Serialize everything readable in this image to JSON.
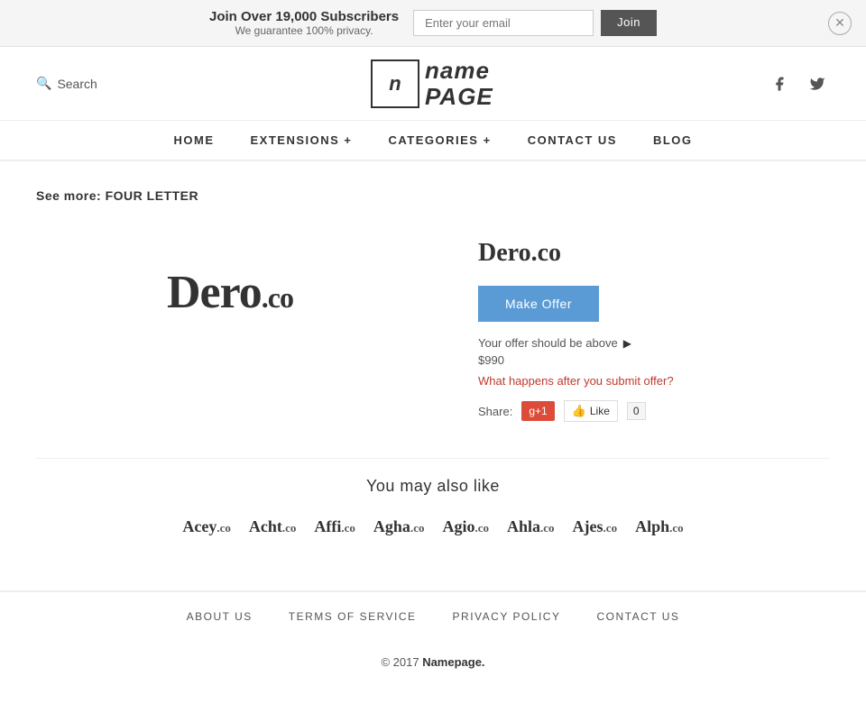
{
  "banner": {
    "main_text": "Join Over 19,000 Subscribers",
    "sub_text": "We guarantee 100% privacy.",
    "email_placeholder": "Enter your email",
    "join_label": "Join"
  },
  "header": {
    "search_label": "Search",
    "logo_icon": "n",
    "logo_name": "name",
    "logo_page": "PAGE",
    "facebook_icon": "f",
    "twitter_icon": "t"
  },
  "nav": {
    "items": [
      {
        "label": "HOME"
      },
      {
        "label": "EXTENSIONS +"
      },
      {
        "label": "CATEGORIES +"
      },
      {
        "label": "CONTACT  US"
      },
      {
        "label": "BLOG"
      }
    ]
  },
  "content": {
    "see_more_label": "See more:",
    "see_more_value": "FOUR LETTER",
    "domain_visual_name": "Dero",
    "domain_visual_tld": ".co",
    "domain_title": "Dero.co",
    "make_offer_label": "Make Offer",
    "offer_info_text": "Your offer should be above",
    "offer_amount": "$990",
    "offer_link_text": "What happens after you submit offer?",
    "share_label": "Share:",
    "gplus_label": "g+1",
    "fb_label": "Like",
    "fb_count": "0"
  },
  "also_like": {
    "title": "You may also like",
    "domains": [
      {
        "name": "Acey",
        "tld": ".co"
      },
      {
        "name": "Acht",
        "tld": ".co"
      },
      {
        "name": "Affi",
        "tld": ".co"
      },
      {
        "name": "Agha",
        "tld": ".co"
      },
      {
        "name": "Agio",
        "tld": ".co"
      },
      {
        "name": "Ahla",
        "tld": ".co"
      },
      {
        "name": "Ajes",
        "tld": ".co"
      },
      {
        "name": "Alph",
        "tld": ".co"
      }
    ]
  },
  "footer": {
    "links": [
      {
        "label": "ABOUT  US"
      },
      {
        "label": "TERMS  OF  SERVICE"
      },
      {
        "label": "PRIVACY  POLICY"
      },
      {
        "label": "CONTACT  US"
      }
    ],
    "copyright": "© 2017",
    "brand": "Namepage.",
    "period": ""
  }
}
